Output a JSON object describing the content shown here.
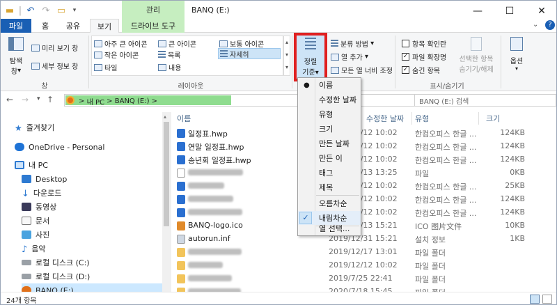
{
  "quickaccess": {
    "icons": [
      "folder-icon",
      "undo-icon",
      "redo-icon",
      "folder-icon",
      "dropdown-icon"
    ],
    "separator": "|"
  },
  "context_tab": "관리",
  "title": "BANQ (E:)",
  "window_controls": {
    "minimize": "—",
    "maximize": "☐",
    "close": "✕"
  },
  "tabs": {
    "file": "파일",
    "home": "홈",
    "share": "공유",
    "view": "보기",
    "drive_tools": "드라이브 도구"
  },
  "ribbon": {
    "pane_group": {
      "navigation_pane": "탐색",
      "navigation_pane2": "창",
      "preview_pane": "미리 보기 창",
      "details_pane": "세부 정보 창",
      "label": "창"
    },
    "layout_group": {
      "extra_large": "아주 큰 아이콘",
      "large": "큰 아이콘",
      "medium": "보통 아이콘",
      "small": "작은 아이콘",
      "list": "목록",
      "details": "자세히",
      "tiles": "타일",
      "content": "내용",
      "label": "레이아웃"
    },
    "sort": {
      "label1": "정렬",
      "label2": "기준",
      "group_by": "분류 방법",
      "add_columns": "열 추가",
      "size_all": "모든 열 너비 조정"
    },
    "showhide": {
      "item_checkboxes": "항목 확인란",
      "file_ext": "파일 확장명",
      "hidden_items": "숨긴 항목",
      "file_ext_checked": true,
      "hidden_items_checked": true,
      "hide_selected": "선택한 항목",
      "hide_selected2": "숨기기/해제",
      "label": "표시/숨기기"
    },
    "options": "옵션"
  },
  "address": {
    "pc": "내 PC",
    "drive": "BANQ (E:)",
    "separator": ">"
  },
  "search_placeholder": "BANQ (E:) 검색",
  "nav": [
    {
      "label": "즐겨찾기",
      "icon": "star-icon"
    },
    {
      "label": "OneDrive - Personal",
      "icon": "cloud-icon"
    },
    {
      "label": "내 PC",
      "icon": "computer-icon"
    },
    {
      "label": "Desktop",
      "icon": "desktop-icon"
    },
    {
      "label": "다운로드",
      "icon": "download-icon"
    },
    {
      "label": "동영상",
      "icon": "video-icon"
    },
    {
      "label": "문서",
      "icon": "document-icon"
    },
    {
      "label": "사진",
      "icon": "picture-icon"
    },
    {
      "label": "음악",
      "icon": "music-icon"
    },
    {
      "label": "로컬 디스크 (C:)",
      "icon": "disk-icon"
    },
    {
      "label": "로컬 디스크 (D:)",
      "icon": "disk-icon"
    },
    {
      "label": "BANQ (E:)",
      "icon": "drive-icon"
    }
  ],
  "columns": {
    "name": "이름",
    "date": "수정한 날짜",
    "type": "유형",
    "size": "크기"
  },
  "files": [
    {
      "name": "일정표.hwp",
      "date": "2019/12/12 10:02",
      "type": "한컴오피스 한글 ...",
      "size": "124KB",
      "icon": "hwp-icon"
    },
    {
      "name": "연말 일정표.hwp",
      "date": "2019/12/12 10:02",
      "type": "한컴오피스 한글 ...",
      "size": "124KB",
      "icon": "hwp-icon"
    },
    {
      "name": "송년회 일정표.hwp",
      "date": "2019/12/12 10:02",
      "type": "한컴오피스 한글 ...",
      "size": "124KB",
      "icon": "hwp-icon"
    },
    {
      "name": "",
      "date": "2019/12/13 13:25",
      "type": "파일",
      "size": "0KB",
      "icon": "file-icon"
    },
    {
      "name": "",
      "date": "2019/12/12 10:02",
      "type": "한컴오피스 한글 ...",
      "size": "25KB",
      "icon": "hwp-icon"
    },
    {
      "name": "",
      "date": "2019/12/12 10:02",
      "type": "한컴오피스 한글 ...",
      "size": "124KB",
      "icon": "hwp-icon"
    },
    {
      "name": "",
      "date": "2019/12/12 10:02",
      "type": "한컴오피스 한글 ...",
      "size": "124KB",
      "icon": "hwp-icon"
    },
    {
      "name": "BANQ-logo.ico",
      "date": "2019/12/13 15:21",
      "type": "ICO 图片文件",
      "size": "10KB",
      "icon": "ico-icon"
    },
    {
      "name": "autorun.inf",
      "date": "2019/12/31 15:21",
      "type": "설치 정보",
      "size": "1KB",
      "icon": "inf-icon"
    },
    {
      "name": "",
      "date": "2019/12/17 13:01",
      "type": "파일 폴더",
      "size": "",
      "icon": "folder-icon"
    },
    {
      "name": "",
      "date": "2019/12/12 10:02",
      "type": "파일 폴더",
      "size": "",
      "icon": "folder-icon"
    },
    {
      "name": "",
      "date": "2019/7/25 22:41",
      "type": "파일 폴더",
      "size": "",
      "icon": "folder-icon"
    },
    {
      "name": "",
      "date": "2020/7/18 15:45",
      "type": "파일 폴더",
      "size": "",
      "icon": "folder-icon"
    }
  ],
  "sort_menu": {
    "items": [
      "이름",
      "수정한 날짜",
      "유형",
      "크기",
      "만든 날짜",
      "만든 이",
      "태그",
      "제목"
    ],
    "selected_item": "이름",
    "order": [
      "오름차순",
      "내림차순"
    ],
    "selected_order": "내림차순",
    "choose_columns": "열 선택..."
  },
  "status": {
    "count": "24개 항목"
  },
  "colors": {
    "accent": "#1a5fb4",
    "context": "#c6eec0",
    "highlight": "#e02020",
    "address_fill": "#8fdc8f"
  }
}
